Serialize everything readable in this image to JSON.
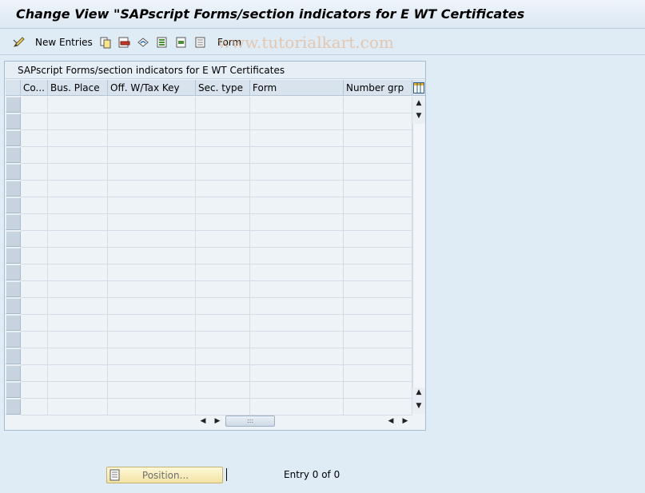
{
  "window": {
    "title": "Change View \"SAPscript Forms/section indicators  for E WT Certificates"
  },
  "toolbar": {
    "new_entries_label": "New Entries",
    "form_label": "Form",
    "icons": [
      "edit-toggle-icon",
      "copy-icon",
      "delete-icon",
      "undo-icon",
      "select-all-icon",
      "select-block-icon",
      "deselect-all-icon"
    ]
  },
  "watermark": "www.tutorialkart.com",
  "table": {
    "title": "SAPscript Forms/section indicators  for E WT Certificates",
    "columns": [
      "Co...",
      "Bus. Place",
      "Off. W/Tax Key",
      "Sec. type",
      "Form",
      "Number grp"
    ],
    "row_count": 19,
    "rows": []
  },
  "footer": {
    "position_button_label": "Position...",
    "entry_info": "Entry 0 of 0"
  },
  "colors": {
    "background": "#dfebf5",
    "position_button": "#f6eab5"
  }
}
